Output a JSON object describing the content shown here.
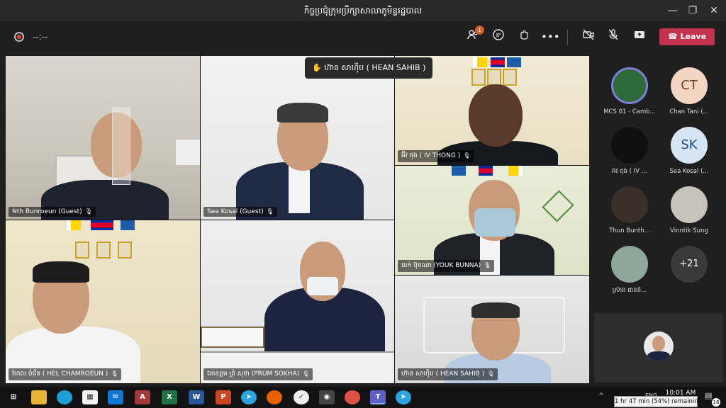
{
  "window": {
    "title": "កិច្ចប្រជុំក្រុមប្រឹក្សាសាលាភូមិន្ទរដ្ឋបាល",
    "minimize": "—",
    "restore": "❐",
    "close": "✕"
  },
  "toolbar": {
    "timer": "--:--",
    "participants_badge": "1",
    "leave_label": "Leave",
    "icons": [
      "participants-icon",
      "chat-icon",
      "raise-hand-icon",
      "more-options-icon",
      "camera-off-icon",
      "mic-off-icon",
      "share-icon"
    ]
  },
  "raised_hand": {
    "label": "ហ៊ាន សាហ៊ីប ( HEAN SAHIB )"
  },
  "tiles": [
    {
      "name": "Nth Bunroeun (Guest)"
    },
    {
      "name": "Sea Kosal (Guest)"
    },
    {
      "name": "អ៊ីវ ថុង ( IV THONG )"
    },
    {
      "name": "យក់ ប៊ុនណា (YOUK BUNNA)"
    },
    {
      "name": "ហែល ចំរើន ( HEL CHAMROEUN )"
    },
    {
      "name": "ឯកឧត្តម ព្រំ សុខា (PRUM SOKHA)"
    },
    {
      "name": "ហ៊ាន សាហ៊ីប ( HEAN SAHIB )"
    }
  ],
  "roster": [
    {
      "name": "MCS 01 - Camb..."
    },
    {
      "name": "Chan Tani (...",
      "initials": "CT"
    },
    {
      "name": "អ៊ីវ ថុង ( IV ..."
    },
    {
      "name": "Sea Kosal (...",
      "initials": "SK"
    },
    {
      "name": "Thun Bunth..."
    },
    {
      "name": "Vinntik Sung"
    },
    {
      "name": "ស្រ៊ាង ផាន់និ..."
    },
    {
      "name": "",
      "initials": "+21"
    }
  ],
  "taskbar": {
    "time": "10:01 AM",
    "date": "",
    "lang": "ENG",
    "battery_tooltip": "1 hr 47 min (54%) remaining",
    "notification_count": "16"
  },
  "colors": {
    "leave": "#c4314b",
    "accent": "#6264a7"
  }
}
